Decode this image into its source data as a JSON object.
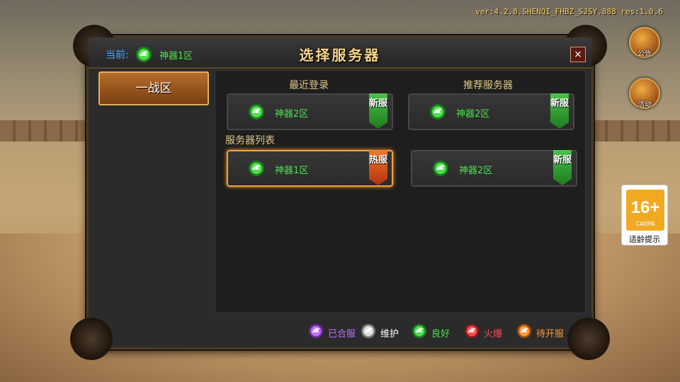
{
  "version": "ver:4.2.8.SHENQI_FHBZ_SJSY.888 res:1.0.6",
  "side_buttons": [
    {
      "label": "公告"
    },
    {
      "label": "活动"
    }
  ],
  "age_rating": {
    "number": "16+",
    "org": "CADPA",
    "tip": "适龄提示"
  },
  "panel": {
    "title": "选择服务器",
    "close_label": "×",
    "current_label": "当前:",
    "current_server": "神器1区"
  },
  "zones": [
    {
      "label": "一战区"
    }
  ],
  "recent": {
    "title": "最近登录",
    "server": {
      "name": "神器2区",
      "tag": "新服"
    }
  },
  "recommended": {
    "title": "推荐服务器",
    "server": {
      "name": "神器2区",
      "tag": "新服"
    }
  },
  "server_list": {
    "title": "服务器列表",
    "servers": [
      {
        "name": "神器1区",
        "tag": "热服",
        "selected": true
      },
      {
        "name": "神器2区",
        "tag": "新服",
        "selected": false
      }
    ]
  },
  "legend": [
    {
      "label": "已合服",
      "color": "#c070ff"
    },
    {
      "label": "维护",
      "color": "#ffffff"
    },
    {
      "label": "良好",
      "color": "#4de04d"
    },
    {
      "label": "火爆",
      "color": "#ff4a4a"
    },
    {
      "label": "待开服",
      "color": "#ff9a3a"
    }
  ]
}
